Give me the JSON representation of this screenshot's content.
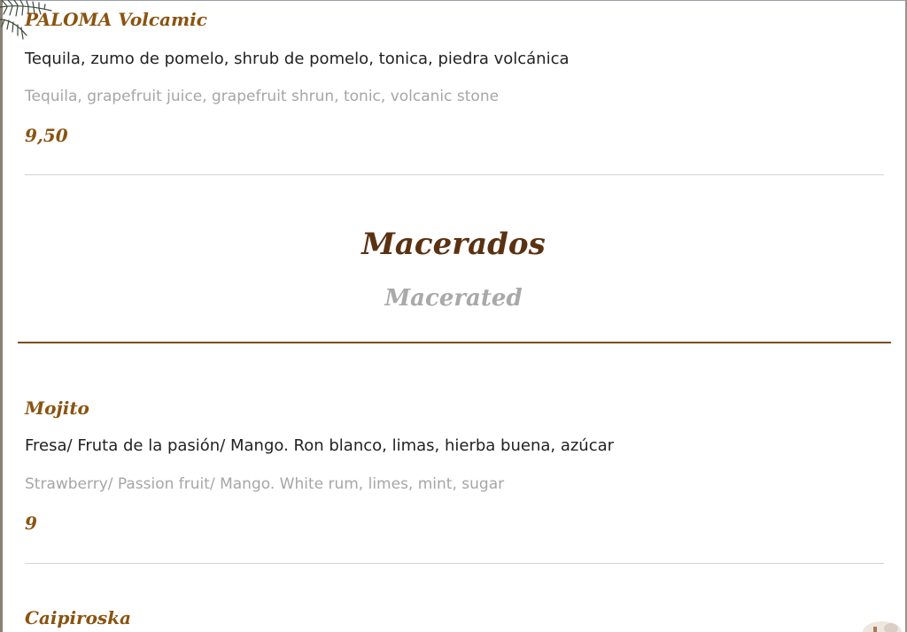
{
  "items_top": {
    "name": "PALOMA Volcamic",
    "desc_es": "Tequila, zumo de pomelo, shrub de pomelo, tonica, piedra volcánica",
    "desc_en": "Tequila, grapefruit juice, grapefruit shrun, tonic, volcanic stone",
    "price": "9,50"
  },
  "section": {
    "title": "Macerados",
    "subtitle": "Macerated"
  },
  "items": [
    {
      "name": "Mojito",
      "desc_es": "Fresa/ Fruta de la pasión/ Mango. Ron blanco, limas, hierba buena, azúcar",
      "desc_en": "Strawberry/ Passion fruit/ Mango. White rum, limes, mint, sugar",
      "price": "9"
    },
    {
      "name": "Caipiroska"
    }
  ],
  "colors": {
    "item_name": "#8a5310",
    "section_title": "#5a3212",
    "section_rule": "#7b4d1a",
    "muted": "#a6a6a6"
  },
  "icons": {
    "top_left": "palm-leaf-icon",
    "bottom_right": "decorative-shell-icon"
  }
}
